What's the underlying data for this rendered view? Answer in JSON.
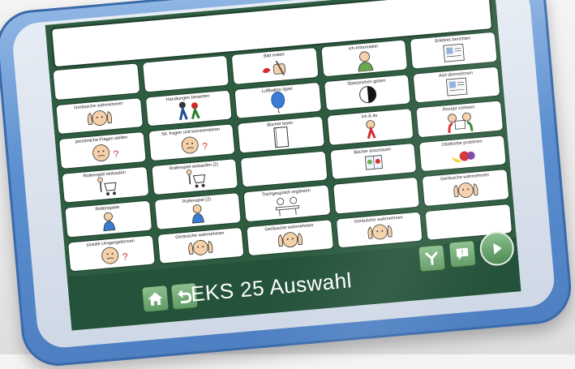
{
  "board_title": "EKS 25 Auswahl",
  "message_bar_text": "",
  "colors": {
    "case_blue": "#5c8fd0",
    "screen_green": "#2d5c40",
    "button_green": "#6fab74"
  },
  "cells": [
    {
      "label": "",
      "icon": "blank"
    },
    {
      "label": "",
      "icon": "blank"
    },
    {
      "label": "Bild malen",
      "icon": "painting-hand-icon"
    },
    {
      "label": "ich-Information",
      "icon": "person-info-icon"
    },
    {
      "label": "Erlebnis berichten",
      "icon": "book-report-icon"
    },
    {
      "label": "Geräusche wahrnehmen",
      "icon": "listening-hands-icon"
    },
    {
      "label": "Handlungen bewerten",
      "icon": "people-action-icon"
    },
    {
      "label": "Luftballon-Spiel",
      "icon": "balloon-icon"
    },
    {
      "label": "Startzeichen geben",
      "icon": "start-signal-icon"
    },
    {
      "label": "Amt übernehmen",
      "icon": "job-board-icon"
    },
    {
      "label": "persönliche Fragen stellen",
      "icon": "question-face-icon"
    },
    {
      "label": "Sit. fragen und kommentieren",
      "icon": "thinking-face-icon"
    },
    {
      "label": "Bücher lesen",
      "icon": "book-icon"
    },
    {
      "label": "ich & du",
      "icon": "me-and-you-icon"
    },
    {
      "label": "Rezept vorlesen",
      "icon": "reading-together-icon"
    },
    {
      "label": "Rollenspiel einkaufen",
      "icon": "shopping-cart-icon"
    },
    {
      "label": "Rollenspiel einkaufen (2)",
      "icon": "shopping-cart-icon"
    },
    {
      "label": "",
      "icon": "blank"
    },
    {
      "label": "Bücher anschauen",
      "icon": "looking-at-book-icon"
    },
    {
      "label": "Obstkörbe probieren",
      "icon": "fruit-icon"
    },
    {
      "label": "Rollenspiele",
      "icon": "playing-child-icon"
    },
    {
      "label": "Rollenspiel (2)",
      "icon": "playing-child-icon"
    },
    {
      "label": "Tischgespräch ergänzen",
      "icon": "table-talk-icon"
    },
    {
      "label": "",
      "icon": "blank"
    },
    {
      "label": "Geräusche wahrnehmen",
      "icon": "listening-hands-icon"
    },
    {
      "label": "soziale Umgangsformen",
      "icon": "thinking-face-icon"
    },
    {
      "label": "Geräusche wahrnehmen",
      "icon": "listening-hands-icon"
    },
    {
      "label": "Geräusche wahrnehmen",
      "icon": "listening-hands-icon"
    },
    {
      "label": "Geräusche wahrnehmen",
      "icon": "listening-hands-icon"
    },
    {
      "label": "",
      "icon": "blank"
    }
  ],
  "nav": {
    "home": "home-icon",
    "back": "back-arrow-icon",
    "choice": "choice-icon",
    "comment": "speech-bubble-icon",
    "play": "play-icon"
  }
}
